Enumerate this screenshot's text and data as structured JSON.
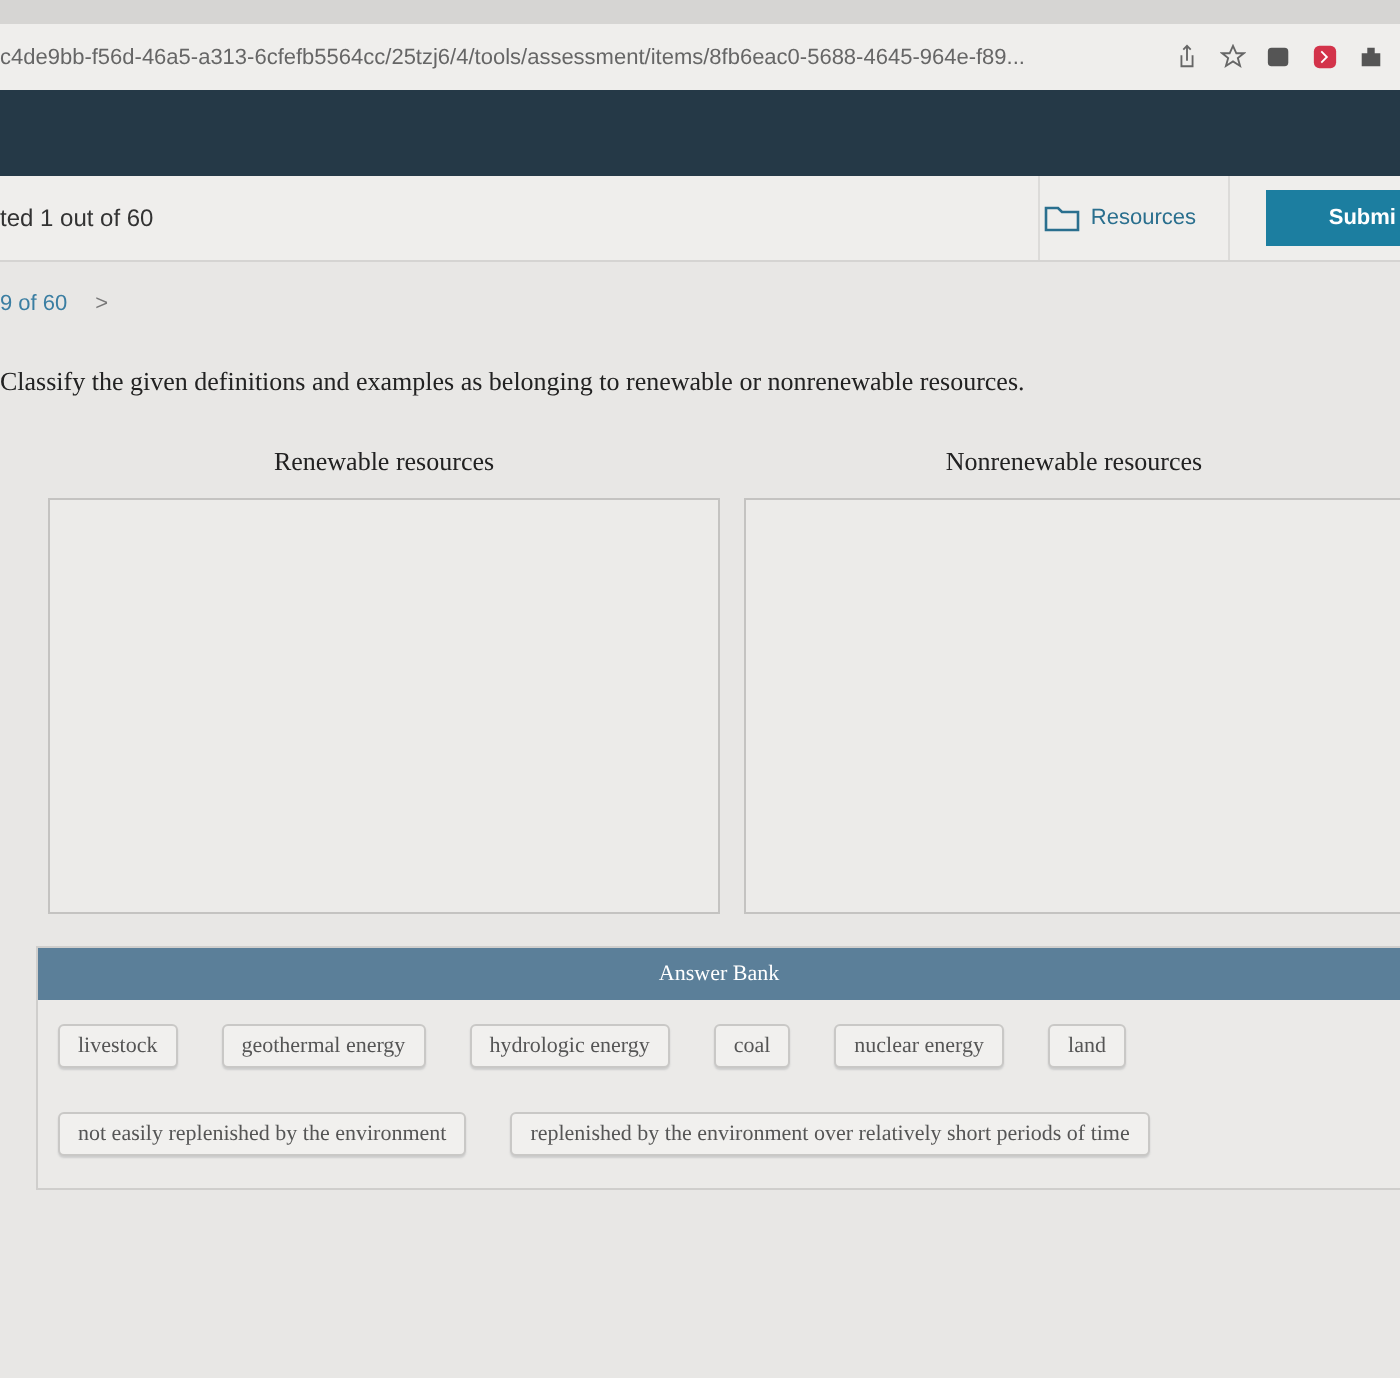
{
  "browser": {
    "url": "c4de9bb-f56d-46a5-a313-6cfefb5564cc/25tzj6/4/tools/assessment/items/8fb6eac0-5688-4645-964e-f89..."
  },
  "header": {
    "progress": "ted 1 out of 60",
    "resources": "Resources",
    "submit": "Submi"
  },
  "nav": {
    "position": "9 of 60",
    "next": ">"
  },
  "question": "Classify the given definitions and examples as belonging to renewable or nonrenewable resources.",
  "bins": [
    {
      "label": "Renewable resources"
    },
    {
      "label": "Nonrenewable resources"
    }
  ],
  "answer_bank": {
    "title": "Answer Bank",
    "items": [
      "livestock",
      "geothermal energy",
      "hydrologic energy",
      "coal",
      "nuclear energy",
      "land",
      "not easily replenished by the environment",
      "replenished by the environment over relatively short periods of time"
    ]
  }
}
